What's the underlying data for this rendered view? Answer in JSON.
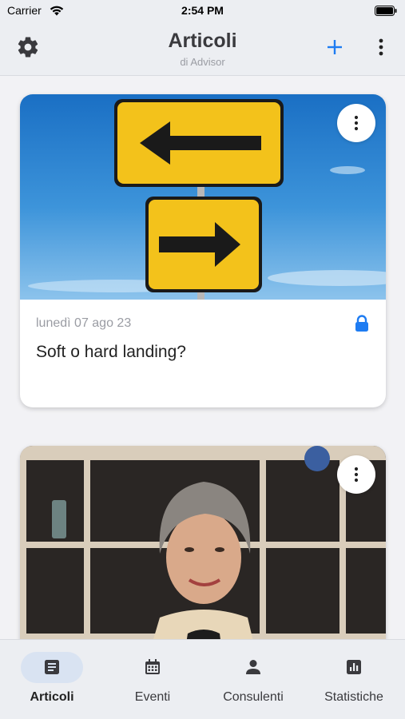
{
  "status_bar": {
    "carrier": "Carrier",
    "time": "2:54 PM"
  },
  "header": {
    "title": "Articoli",
    "subtitle": "di Advisor"
  },
  "articles": [
    {
      "date": "lunedì 07 ago 23",
      "title": "Soft o hard landing?",
      "locked": true,
      "image": "road-signs-arrows"
    },
    {
      "date": "",
      "title": "",
      "image": "portrait-woman"
    }
  ],
  "tabs": [
    {
      "label": "Articoli",
      "icon": "article-icon",
      "active": true
    },
    {
      "label": "Eventi",
      "icon": "calendar-icon",
      "active": false
    },
    {
      "label": "Consulenti",
      "icon": "person-icon",
      "active": false
    },
    {
      "label": "Statistiche",
      "icon": "bar-chart-icon",
      "active": false
    }
  ],
  "colors": {
    "accent": "#1e7cf2",
    "header_bg": "#eceef2",
    "tab_active_pill": "#d9e3f2"
  }
}
